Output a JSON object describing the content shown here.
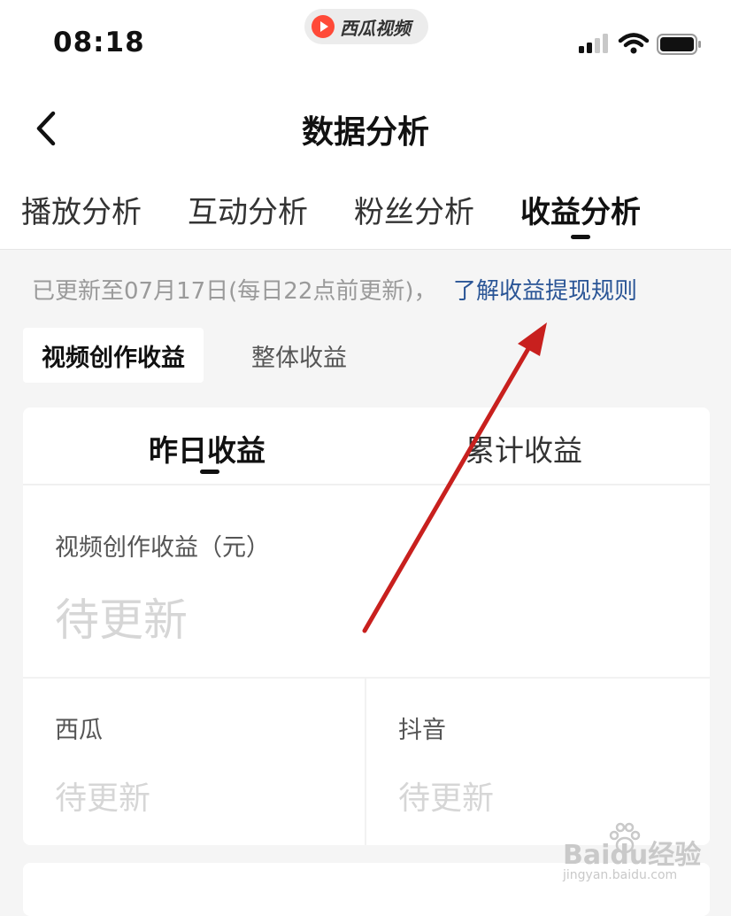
{
  "status_bar": {
    "time": "08:18",
    "app_name": "西瓜视频",
    "icons": [
      "signal-icon",
      "wifi-icon",
      "battery-icon"
    ]
  },
  "header": {
    "title": "数据分析",
    "back_icon": "chevron-left-icon"
  },
  "tabs": [
    {
      "label": "播放分析",
      "active": false
    },
    {
      "label": "互动分析",
      "active": false
    },
    {
      "label": "粉丝分析",
      "active": false
    },
    {
      "label": "收益分析",
      "active": true
    }
  ],
  "notice": {
    "text": "已更新至07月17日(每日22点前更新)，",
    "link": "了解收益提现规则"
  },
  "subtabs": [
    {
      "label": "视频创作收益",
      "active": true
    },
    {
      "label": "整体收益",
      "active": false
    }
  ],
  "period_tabs": [
    {
      "label": "昨日收益",
      "active": true
    },
    {
      "label": "累计收益",
      "active": false
    }
  ],
  "metric": {
    "label": "视频创作收益（元）",
    "value": "待更新"
  },
  "breakdown": [
    {
      "label": "西瓜",
      "value": "待更新"
    },
    {
      "label": "抖音",
      "value": "待更新"
    }
  ],
  "watermark": {
    "text": "Baidu经验",
    "sub": "jingyan.baidu.com"
  },
  "colors": {
    "link": "#2a5596",
    "annotation_arrow": "#c8201e",
    "app_logo": "#ff4a38"
  }
}
